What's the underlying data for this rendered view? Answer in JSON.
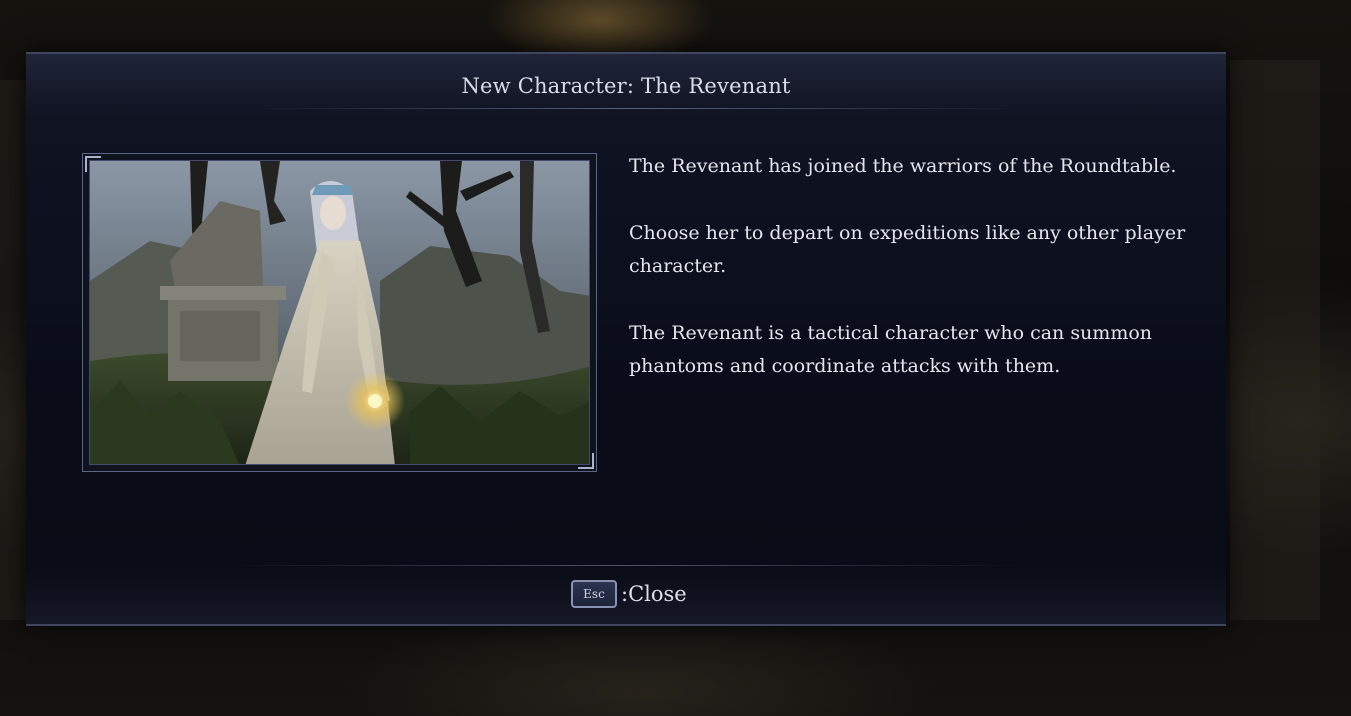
{
  "dialog": {
    "title": "New Character: The Revenant",
    "image_alt": "The Revenant character portrait",
    "description": [
      "The Revenant has joined the warriors of the Roundtable.",
      "Choose her to depart on expeditions like any other player character.",
      "The Revenant is a tactical character who can summon phantoms and coordinate attacks with them."
    ],
    "close": {
      "key": "Esc",
      "label": ":Close"
    }
  },
  "colors": {
    "panel": "#0a0d19",
    "border": "#3e4660",
    "text": "#e4e6ee"
  }
}
